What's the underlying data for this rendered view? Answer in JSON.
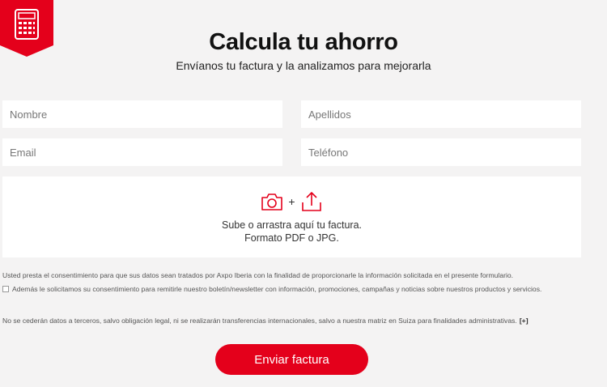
{
  "header": {
    "title": "Calcula tu ahorro",
    "subtitle": "Envíanos tu factura y la analizamos para mejorarla",
    "badge_icon": "calculator-icon"
  },
  "form": {
    "nombre_placeholder": "Nombre",
    "apellidos_placeholder": "Apellidos",
    "email_placeholder": "Email",
    "telefono_placeholder": "Teléfono"
  },
  "upload": {
    "icons": [
      "camera-icon",
      "upload-icon"
    ],
    "plus": "+",
    "line1": "Sube o arrastra aquí tu factura.",
    "line2": "Formato PDF o JPG."
  },
  "legal": {
    "consent": "Usted presta el consentimiento para que sus datos sean tratados por Axpo Iberia con la finalidad de proporcionarle la información solicitada en el presente formulario.",
    "newsletter": "Además le solicitamos su consentimiento para remitirle nuestro boletín/newsletter con información, promociones, campañas y noticias sobre nuestros productos y servicios.",
    "third_party": "No se cederán datos a terceros, salvo obligación legal, ni se realizarán transferencias internacionales, salvo a nuestra matriz en Suiza para finalidades administrativas.",
    "more_link": "[+]"
  },
  "submit": {
    "label": "Enviar factura"
  },
  "colors": {
    "accent": "#e4001b",
    "background": "#f4f3f3"
  }
}
